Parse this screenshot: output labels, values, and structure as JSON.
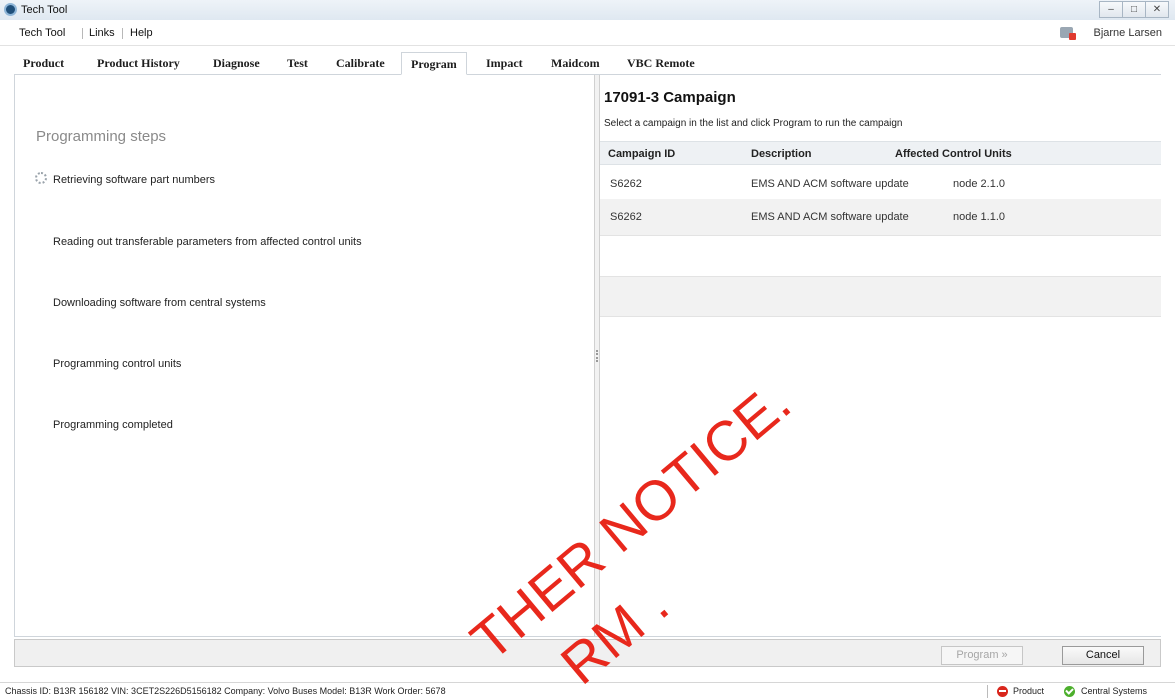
{
  "window": {
    "title": "Tech Tool",
    "controls": [
      "–",
      "□",
      "✕"
    ]
  },
  "menu": {
    "items": [
      "Tech Tool",
      "Links",
      "Help"
    ],
    "user": "Bjarne Larsen"
  },
  "tabs": [
    "Product",
    "Product History",
    "Diagnose",
    "Test",
    "Calibrate",
    "Program",
    "Impact",
    "Maidcom",
    "VBC Remote"
  ],
  "active_tab": "Program",
  "left": {
    "title": "Programming steps",
    "steps": [
      "Retrieving software part numbers",
      "Reading out transferable parameters from affected control units",
      "Downloading software from central systems",
      "Programming control units",
      "Programming completed"
    ]
  },
  "right": {
    "title": "17091-3 Campaign",
    "instruction": "Select a campaign in the list and click Program to run the campaign",
    "columns": [
      "Campaign ID",
      "Description",
      "Affected Control Units"
    ],
    "rows": [
      {
        "id": "S6262",
        "description": "EMS AND ACM software update",
        "units": "node 2.1.0"
      },
      {
        "id": "S6262",
        "description": "EMS AND ACM software update",
        "units": "node 1.1.0"
      }
    ]
  },
  "buttons": {
    "program": "Program »",
    "cancel": "Cancel"
  },
  "status": {
    "info": "Chassis ID: B13R 156182   VIN: 3CET2S226D5156182   Company: Volvo Buses   Model: B13R   Work Order: 5678",
    "product": "Product",
    "central": "Central Systems"
  },
  "watermark": {
    "line1": "THER NOTICE.",
    "line2": "RM ."
  }
}
